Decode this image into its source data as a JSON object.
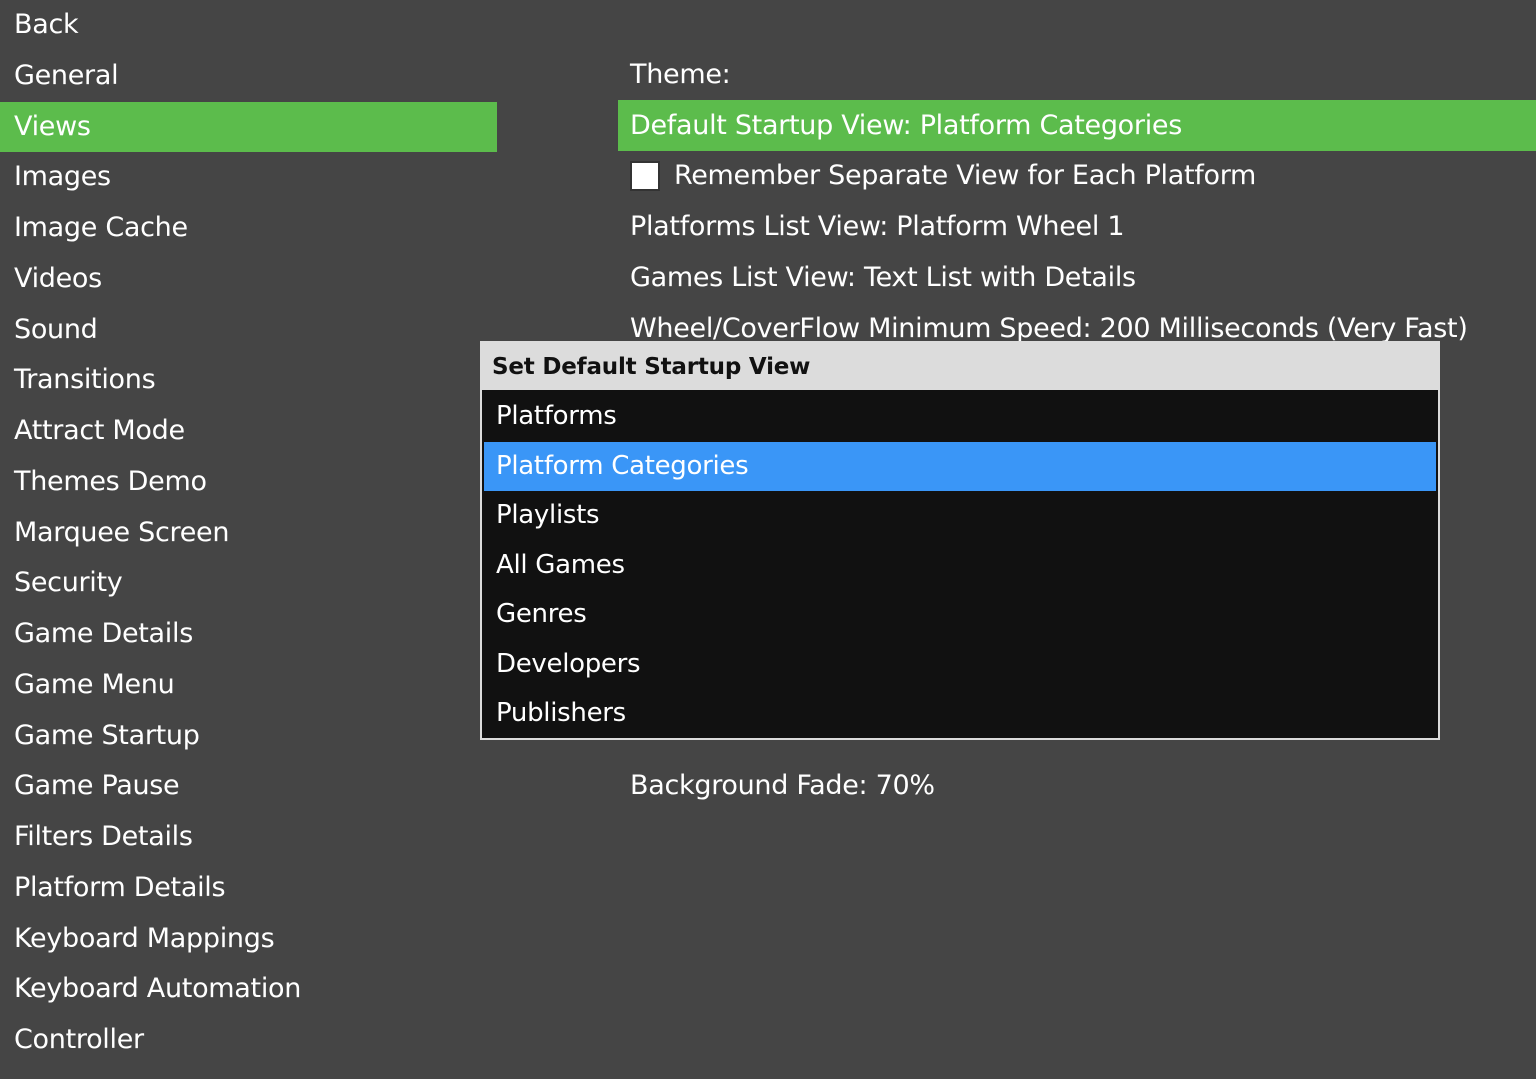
{
  "nav": {
    "items": [
      {
        "label": "Back"
      },
      {
        "label": "General"
      },
      {
        "label": "Views",
        "selected": true
      },
      {
        "label": "Images"
      },
      {
        "label": "Image Cache"
      },
      {
        "label": "Videos"
      },
      {
        "label": "Sound"
      },
      {
        "label": "Transitions"
      },
      {
        "label": "Attract Mode"
      },
      {
        "label": "Themes Demo"
      },
      {
        "label": "Marquee Screen"
      },
      {
        "label": "Security"
      },
      {
        "label": "Game Details"
      },
      {
        "label": "Game Menu"
      },
      {
        "label": "Game Startup"
      },
      {
        "label": "Game Pause"
      },
      {
        "label": "Filters Details"
      },
      {
        "label": "Platform Details"
      },
      {
        "label": "Keyboard Mappings"
      },
      {
        "label": "Keyboard Automation"
      },
      {
        "label": "Controller"
      }
    ]
  },
  "settings": {
    "theme": "Theme:",
    "default_startup_view": "Default Startup View: Platform Categories",
    "remember_separate_view": "Remember Separate View for Each Platform",
    "remember_separate_view_checked": false,
    "platforms_list_view": "Platforms List View: Platform Wheel 1",
    "games_list_view": "Games List View: Text List with Details",
    "wheel_min_speed": "Wheel/CoverFlow Minimum Speed: 200 Milliseconds (Very Fast)",
    "background_fade": "Background Fade: 70%"
  },
  "popup": {
    "title": "Set Default Startup View",
    "options": [
      {
        "label": "Platforms"
      },
      {
        "label": "Platform Categories",
        "highlighted": true
      },
      {
        "label": "Playlists"
      },
      {
        "label": "All Games"
      },
      {
        "label": "Genres"
      },
      {
        "label": "Developers"
      },
      {
        "label": "Publishers"
      }
    ]
  },
  "colors": {
    "background": "#454545",
    "selected_green": "#5cbc4c",
    "highlight_blue": "#3a96f7",
    "popup_bg": "#111111",
    "popup_title_bg": "#dcdcdc"
  }
}
